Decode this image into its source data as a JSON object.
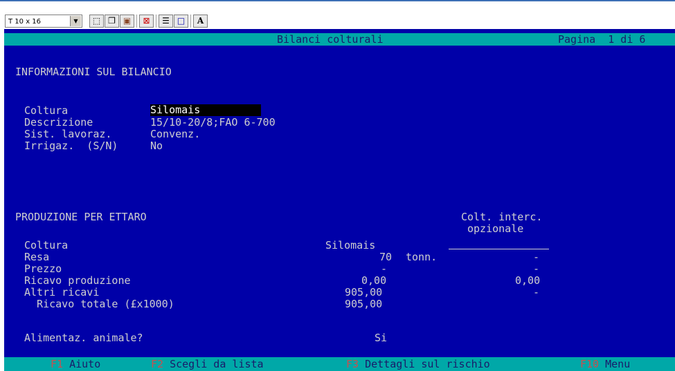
{
  "toolbar": {
    "font_select": "T 10 x 16",
    "buttons": [
      "mark",
      "copy",
      "paste",
      "fullscreen",
      "properties",
      "background",
      "font"
    ],
    "font_button_label": "A"
  },
  "titlebar": {
    "title": "Bilanci colturali",
    "page": "Pagina  1 di 6"
  },
  "info": {
    "heading": "INFORMAZIONI SUL BILANCIO",
    "rows": [
      {
        "label": "Coltura",
        "value": "Silomais"
      },
      {
        "label": "Descrizione",
        "value": "15/10-20/8;FAO 6-700"
      },
      {
        "label": "Sist. lavoraz.",
        "value": "Convenz."
      },
      {
        "label": "Irrigaz.  (S/N)",
        "value": "No"
      }
    ]
  },
  "produzione": {
    "heading": "PRODUZIONE PER ETTARO",
    "col2_line1": "Colt. interc.",
    "col2_line2": "opzionale",
    "rows": [
      {
        "label": "Coltura",
        "v1": "Silomais",
        "unit": "",
        "v2": ""
      },
      {
        "label": "Resa",
        "v1": "70",
        "unit": "tonn.",
        "v2": "-"
      },
      {
        "label": "Prezzo",
        "v1": "-",
        "unit": "",
        "v2": "-"
      },
      {
        "label": "Ricavo produzione",
        "v1": "0,00",
        "unit": "",
        "v2": "0,00"
      },
      {
        "label": "Altri ricavi",
        "v1": "905,00",
        "unit": "",
        "v2": "-"
      },
      {
        "label": "  Ricavo totale (£x1000)",
        "v1": "905,00",
        "unit": "",
        "v2": ""
      }
    ],
    "alimentaz_label": "Alimentaz. animale?",
    "alimentaz_value": "Si"
  },
  "statusbar": {
    "keys": [
      {
        "key": "F1",
        "label": "Aiuto"
      },
      {
        "key": "F2",
        "label": "Scegli da lista"
      },
      {
        "key": "F3",
        "label": "Dettagli sul rischio"
      },
      {
        "key": "F10",
        "label": "Menu"
      }
    ]
  },
  "colors": {
    "screen_bg": "#0000a8",
    "bar_bg": "#00a8a8",
    "text": "#cfcfcf",
    "fkey": "#c85050"
  }
}
